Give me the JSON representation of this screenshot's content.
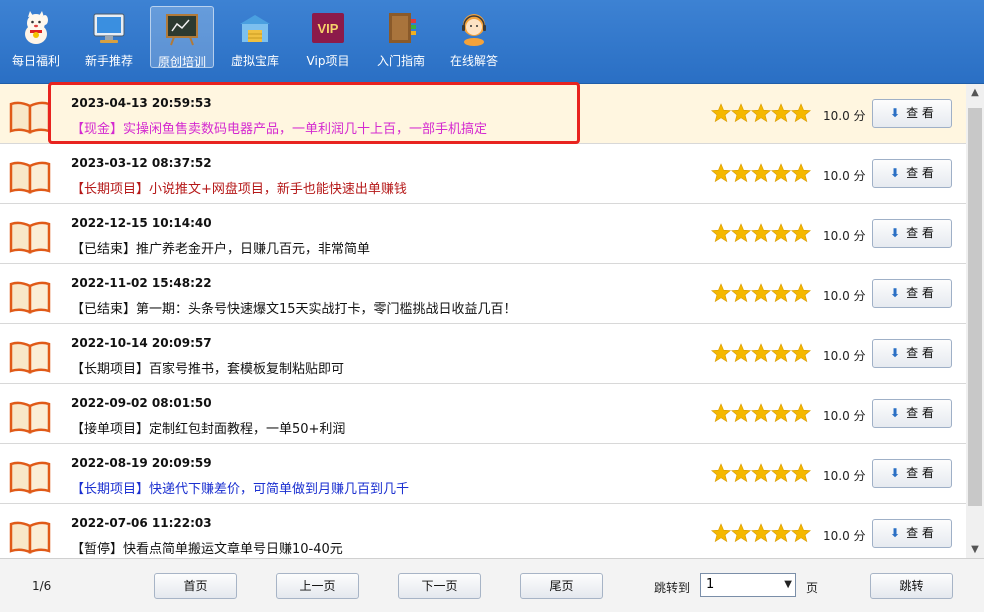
{
  "toolbar": {
    "items": [
      {
        "label": "每日福利",
        "icon": "lucky-cat-icon"
      },
      {
        "label": "新手推荐",
        "icon": "monitor-icon"
      },
      {
        "label": "原创培训",
        "icon": "blackboard-icon",
        "active": true
      },
      {
        "label": "虚拟宝库",
        "icon": "warehouse-icon"
      },
      {
        "label": "Vip项目",
        "icon": "vip-badge-icon",
        "badge_text": "VIP"
      },
      {
        "label": "入门指南",
        "icon": "book-guide-icon"
      },
      {
        "label": "在线解答",
        "icon": "support-agent-icon"
      }
    ]
  },
  "list": {
    "score_unit": "分",
    "view_label": "查 看",
    "rows": [
      {
        "date": "2023-04-13 20:59:53",
        "title": "【现金】实操闲鱼售卖数码电器产品，一单利润几十上百，一部手机搞定",
        "title_color": "#d42ad0",
        "score": "10.0",
        "stars": 5,
        "selected": true
      },
      {
        "date": "2023-03-12 08:37:52",
        "title": "【长期项目】小说推文+网盘项目，新手也能快速出单赚钱",
        "title_color": "#b51818",
        "score": "10.0",
        "stars": 5
      },
      {
        "date": "2022-12-15 10:14:40",
        "title": "【已结束】推广养老金开户，日赚几百元，非常简单",
        "title_color": "#111111",
        "score": "10.0",
        "stars": 5
      },
      {
        "date": "2022-11-02 15:48:22",
        "title": "【已结束】第一期：头条号快速爆文15天实战打卡，零门槛挑战日收益几百！",
        "title_color": "#111111",
        "score": "10.0",
        "stars": 5
      },
      {
        "date": "2022-10-14 20:09:57",
        "title": "【长期项目】百家号推书，套模板复制粘贴即可",
        "title_color": "#111111",
        "score": "10.0",
        "stars": 5
      },
      {
        "date": "2022-09-02 08:01:50",
        "title": "【接单项目】定制红包封面教程，一单50+利润",
        "title_color": "#111111",
        "score": "10.0",
        "stars": 5
      },
      {
        "date": "2022-08-19 20:09:59",
        "title": "【长期项目】快递代下赚差价，可简单做到月赚几百到几千",
        "title_color": "#1a2fd0",
        "score": "10.0",
        "stars": 5
      },
      {
        "date": "2022-07-06 11:22:03",
        "title": "【暂停】快看点简单搬运文章单号日赚10-40元",
        "title_color": "#111111",
        "score": "10.0",
        "stars": 5
      }
    ]
  },
  "footer": {
    "page_info": "1/6",
    "first": "首页",
    "prev": "上一页",
    "next": "下一页",
    "last": "尾页",
    "jump_label": "跳转到",
    "jump_value": "1",
    "page_suffix": "页",
    "jump_button": "跳转"
  },
  "colors": {
    "toolbar": "#2f76c9",
    "highlight_border": "#e8231f",
    "selected_row": "#fff6e0",
    "star": "#f5b800"
  }
}
